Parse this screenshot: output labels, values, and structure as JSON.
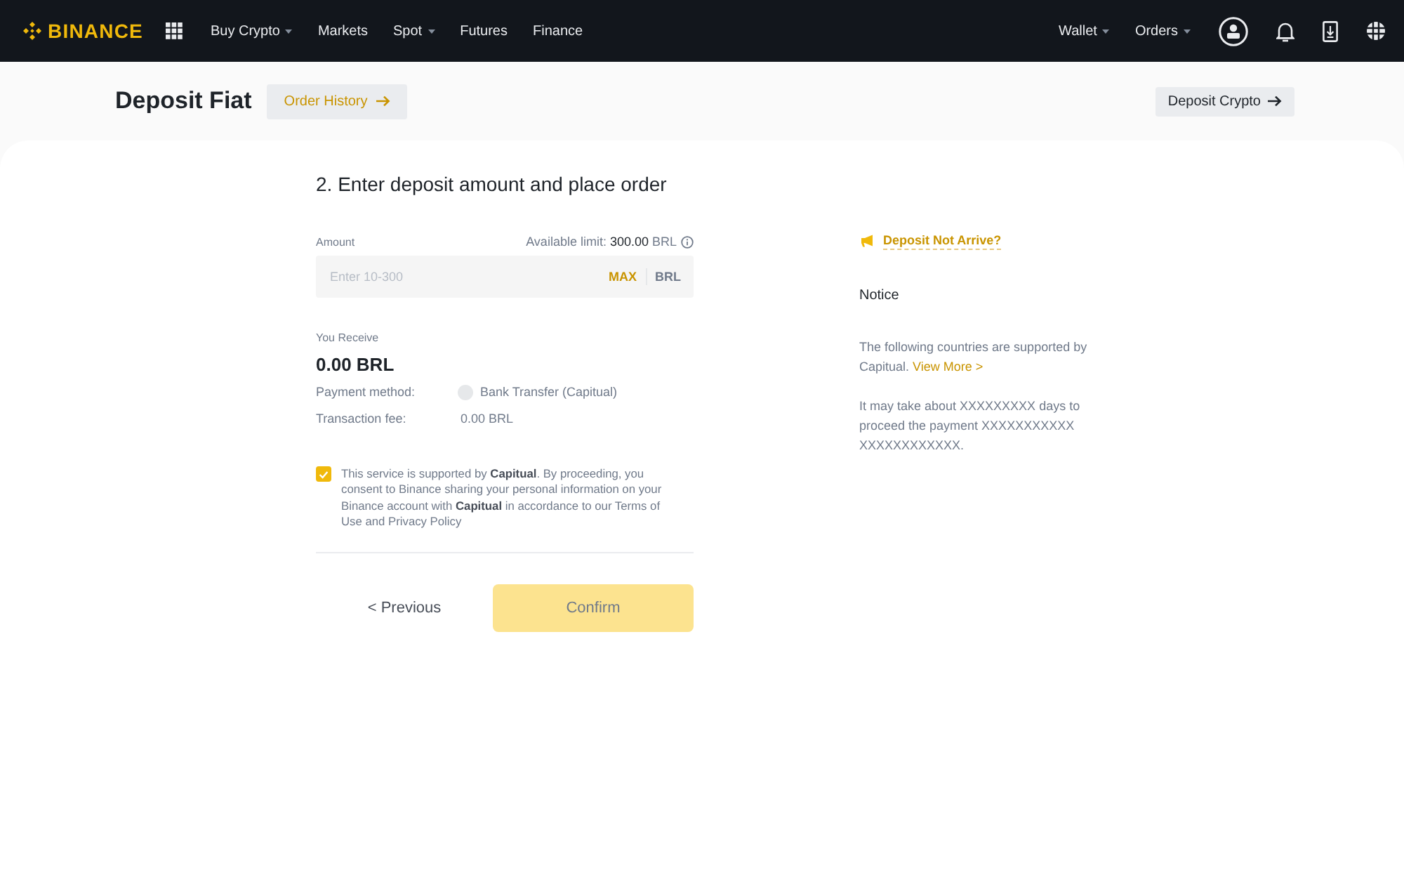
{
  "nav": {
    "logo": "BINANCE",
    "menu": [
      {
        "label": "Buy Crypto",
        "dropdown": true
      },
      {
        "label": "Markets",
        "dropdown": false
      },
      {
        "label": "Spot",
        "dropdown": true
      },
      {
        "label": "Futures",
        "dropdown": false
      },
      {
        "label": "Finance",
        "dropdown": false
      }
    ],
    "right_menu": [
      {
        "label": "Wallet",
        "dropdown": true
      },
      {
        "label": "Orders",
        "dropdown": true
      }
    ]
  },
  "header": {
    "title": "Deposit Fiat",
    "history_button": "Order History",
    "crypto_button": "Deposit Crypto"
  },
  "form": {
    "step_title": "2. Enter deposit amount and place order",
    "amount": {
      "label": "Amount",
      "limit": "Available limit: **300.00** BRL",
      "placeholder": "Enter 10-300",
      "max": "MAX",
      "currency": "BRL"
    },
    "receive": {
      "label": "You Receive",
      "value": "0.00 BRL"
    },
    "details": [
      {
        "kind": "method",
        "label": "Payment method:",
        "value": "Bank Transfer (Capitual)"
      },
      {
        "kind": "plain",
        "label": "Transaction fee:",
        "value": "0.00 BRL"
      }
    ],
    "consent": {
      "checked": true,
      "text": "This service is supported by **Capitual**. By proceeding, you consent to Binance sharing your personal information on your Binance account with **Capitual** in accordance to our Terms of Use and Privacy Policy"
    },
    "previous": "< Previous",
    "confirm": {
      "label": "Confirm",
      "disabled": true
    }
  },
  "side": {
    "help_link": "Deposit Not Arrive?",
    "notice_title": "Notice",
    "notices": [
      {
        "text": "The following countries are supported by Capitual.",
        "link": "View More >"
      },
      {
        "text": "It may take about XXXXXXXXX days to proceed the payment XXXXXXXXXXX XXXXXXXXXXXX."
      }
    ]
  }
}
